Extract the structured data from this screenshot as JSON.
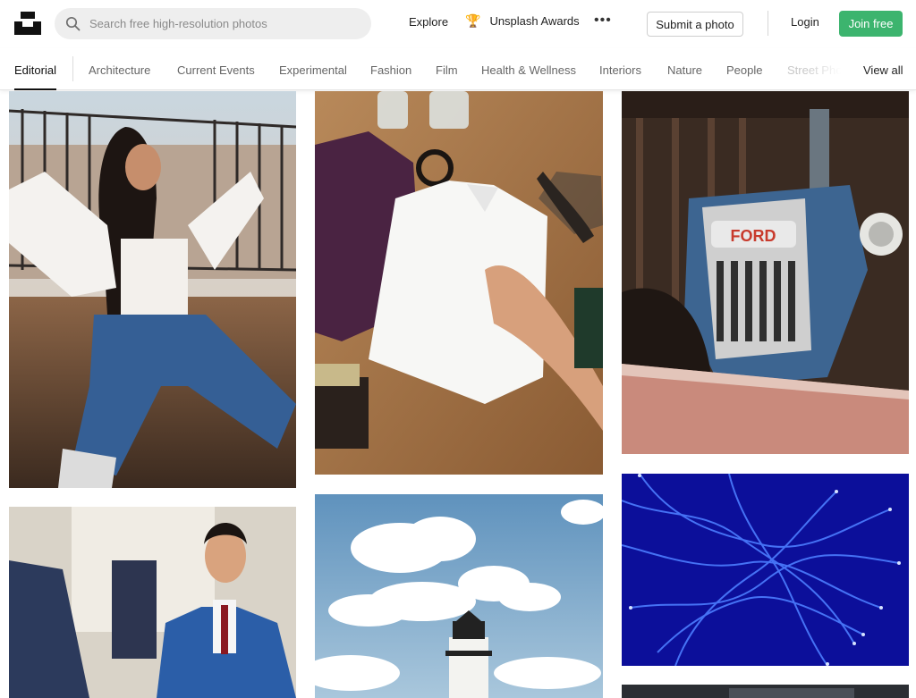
{
  "header": {
    "search_placeholder": "Search free high-resolution photos",
    "explore": "Explore",
    "awards": "Unsplash Awards",
    "more": "•••",
    "submit": "Submit a photo",
    "login": "Login",
    "join": "Join free"
  },
  "tabs": [
    {
      "label": "Editorial",
      "active": true
    },
    {
      "label": "Architecture"
    },
    {
      "label": "Current Events"
    },
    {
      "label": "Experimental"
    },
    {
      "label": "Fashion"
    },
    {
      "label": "Film"
    },
    {
      "label": "Health & Wellness"
    },
    {
      "label": "Interiors"
    },
    {
      "label": "Nature"
    },
    {
      "label": "People"
    },
    {
      "label": "Street Photography"
    },
    {
      "label": "View all"
    }
  ],
  "photos": {
    "col1": [
      "woman-sitting-on-rooftop",
      "man-in-blue-suit"
    ],
    "col2": [
      "shirts-flat-lay",
      "lighthouse-and-clouds"
    ],
    "col3": [
      "ford-tractor",
      "blue-fibers"
    ]
  },
  "colors": {
    "brand": "#111111",
    "join_button": "#3cb46e",
    "search_bg": "#eeeeee",
    "trophy": "#c9971f"
  }
}
